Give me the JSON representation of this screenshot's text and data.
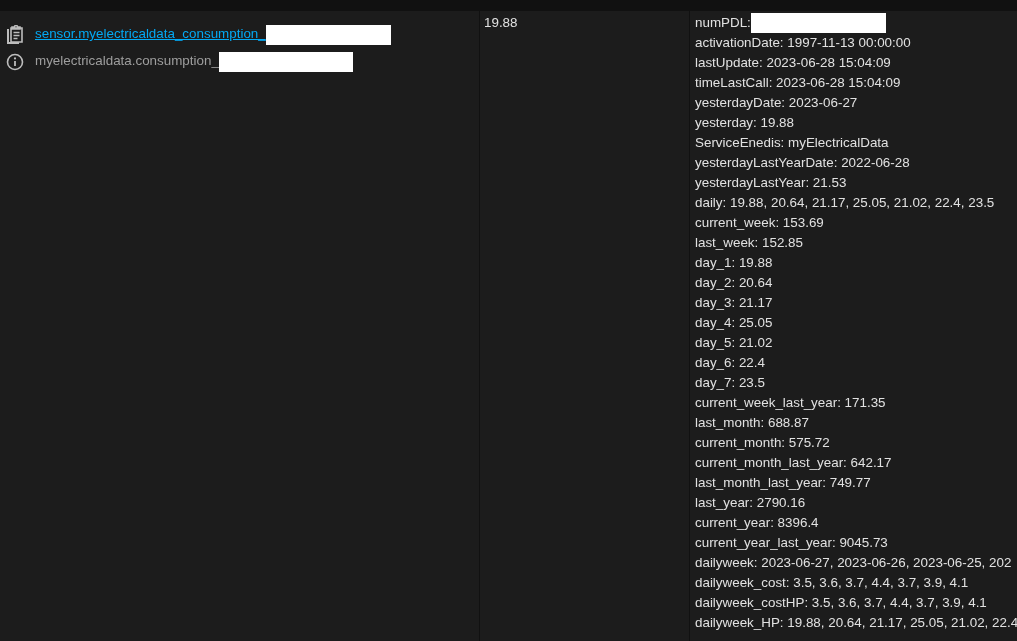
{
  "entity": {
    "entity_id": "sensor.myelectricaldata_consumption_",
    "entity_id_redacted": true,
    "friendly_name": "myelectricaldata.consumption_",
    "friendly_name_redacted": true
  },
  "state": "19.88",
  "attributes": [
    {
      "text": "numPDL:",
      "redacted": true
    },
    {
      "text": "activationDate: 1997-11-13 00:00:00"
    },
    {
      "text": "lastUpdate: 2023-06-28 15:04:09"
    },
    {
      "text": "timeLastCall: 2023-06-28 15:04:09"
    },
    {
      "text": "yesterdayDate: 2023-06-27"
    },
    {
      "text": "yesterday: 19.88"
    },
    {
      "text": "ServiceEnedis: myElectricalData"
    },
    {
      "text": "yesterdayLastYearDate: 2022-06-28"
    },
    {
      "text": "yesterdayLastYear: 21.53"
    },
    {
      "text": "daily: 19.88, 20.64, 21.17, 25.05, 21.02, 22.4, 23.5"
    },
    {
      "text": "current_week: 153.69"
    },
    {
      "text": "last_week: 152.85"
    },
    {
      "text": "day_1: 19.88"
    },
    {
      "text": "day_2: 20.64"
    },
    {
      "text": "day_3: 21.17"
    },
    {
      "text": "day_4: 25.05"
    },
    {
      "text": "day_5: 21.02"
    },
    {
      "text": "day_6: 22.4"
    },
    {
      "text": "day_7: 23.5"
    },
    {
      "text": "current_week_last_year: 171.35"
    },
    {
      "text": "last_month: 688.87"
    },
    {
      "text": "current_month: 575.72"
    },
    {
      "text": "current_month_last_year: 642.17"
    },
    {
      "text": "last_month_last_year: 749.77"
    },
    {
      "text": "last_year: 2790.16"
    },
    {
      "text": "current_year: 8396.4"
    },
    {
      "text": "current_year_last_year: 9045.73"
    },
    {
      "text": "dailyweek: 2023-06-27, 2023-06-26, 2023-06-25, 202"
    },
    {
      "text": "dailyweek_cost: 3.5, 3.6, 3.7, 4.4, 3.7, 3.9, 4.1"
    },
    {
      "text": "dailyweek_costHP: 3.5, 3.6, 3.7, 4.4, 3.7, 3.9, 4.1"
    },
    {
      "text": "dailyweek_HP: 19.88, 20.64, 21.17, 25.05, 21.02, 22.4"
    }
  ]
}
